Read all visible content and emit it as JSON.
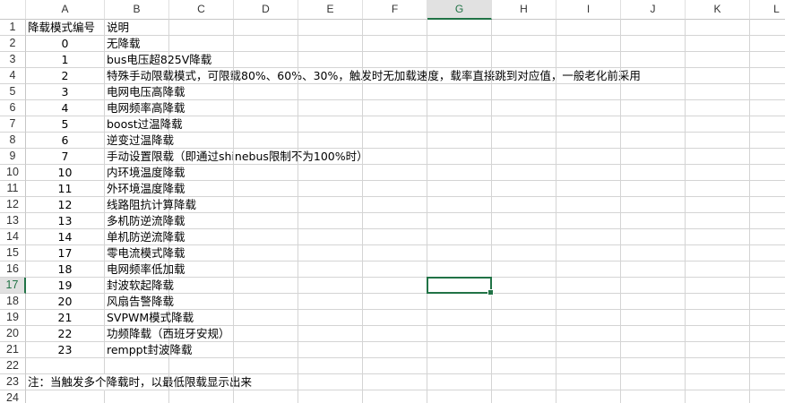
{
  "columns": [
    "A",
    "B",
    "C",
    "D",
    "E",
    "F",
    "G",
    "H",
    "I",
    "J",
    "K",
    "L"
  ],
  "row_numbers": [
    "1",
    "2",
    "3",
    "4",
    "5",
    "6",
    "7",
    "8",
    "9",
    "10",
    "11",
    "12",
    "13",
    "14",
    "15",
    "16",
    "17",
    "18",
    "19",
    "20",
    "21",
    "22",
    "23",
    "24"
  ],
  "active_row": 17,
  "active_column": "G",
  "rows": [
    {
      "a": "降载模式编号",
      "b": "说明"
    },
    {
      "a": "0",
      "b": "无降载"
    },
    {
      "a": "1",
      "b": "bus电压超825V降载"
    },
    {
      "a": "2",
      "b": "特殊手动限载模式，可限载80%、60%、30%，触发时无加载速度，载率直接跳到对应值，一般老化前采用"
    },
    {
      "a": "3",
      "b": "电网电压高降载"
    },
    {
      "a": "4",
      "b": "电网频率高降载"
    },
    {
      "a": "5",
      "b": "boost过温降载"
    },
    {
      "a": "6",
      "b": "逆变过温降载"
    },
    {
      "a": "7",
      "b": "手动设置限载（即通过shinebus限制不为100%时）"
    },
    {
      "a": "10",
      "b": "内环境温度降载"
    },
    {
      "a": "11",
      "b": "外环境温度降载"
    },
    {
      "a": "12",
      "b": "线路阻抗计算降载"
    },
    {
      "a": "13",
      "b": "多机防逆流降载"
    },
    {
      "a": "14",
      "b": "单机防逆流降载"
    },
    {
      "a": "17",
      "b": "零电流模式降载"
    },
    {
      "a": "18",
      "b": "电网频率低加载"
    },
    {
      "a": "19",
      "b": "封波软起降载"
    },
    {
      "a": "20",
      "b": "风扇告警降载"
    },
    {
      "a": "21",
      "b": "SVPWM模式降载"
    },
    {
      "a": "22",
      "b": "功频降载（西班牙安规）"
    },
    {
      "a": "23",
      "b": "remppt封波降载"
    },
    {
      "a": "",
      "b": ""
    },
    {
      "a": "注：当触发多个降载时，以最低限载显示出来",
      "b": ""
    },
    {
      "a": "",
      "b": ""
    }
  ]
}
